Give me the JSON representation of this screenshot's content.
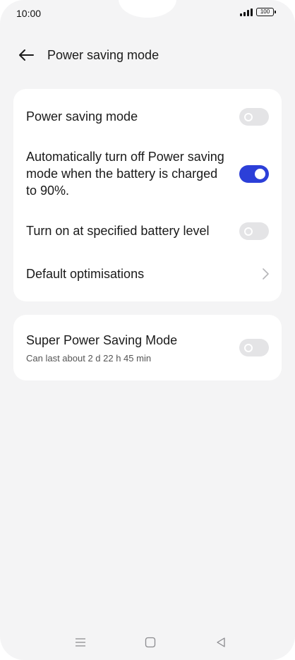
{
  "status_bar": {
    "time": "10:00",
    "battery": "100",
    "icons": [
      "signal-icon",
      "battery-icon"
    ]
  },
  "header": {
    "back_icon": "arrow-left-icon",
    "title": "Power saving mode"
  },
  "settings_card": {
    "items": [
      {
        "label": "Power saving mode",
        "control": "toggle",
        "on": false
      },
      {
        "label": "Automatically turn off Power saving mode when the battery is charged to 90%.",
        "control": "toggle",
        "on": true
      },
      {
        "label": "Turn on at specified battery level",
        "control": "toggle",
        "on": false
      },
      {
        "label": "Default optimisations",
        "control": "chevron-right-icon"
      }
    ]
  },
  "super_card": {
    "label": "Super Power Saving Mode",
    "sublabel": "Can last about 2 d 22 h 45 min",
    "control": "toggle",
    "on": false
  },
  "nav_bar": {
    "buttons": [
      "menu-icon",
      "home-icon",
      "back-triangle-icon"
    ]
  },
  "colors": {
    "background": "#f4f4f5",
    "card": "#ffffff",
    "toggle_on": "#2c3fd8",
    "toggle_off": "#e4e4e6"
  }
}
